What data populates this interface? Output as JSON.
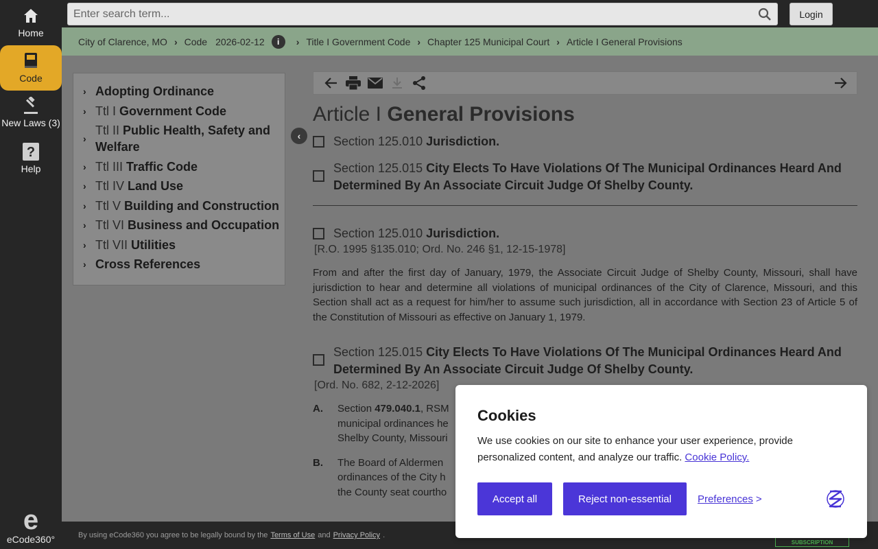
{
  "rail": {
    "home_label": "Home",
    "code_label": "Code",
    "new_laws_label": "New Laws (3)",
    "help_label": "Help",
    "logo_text": "eCode360°"
  },
  "search": {
    "placeholder": "Enter search term..."
  },
  "login_label": "Login",
  "breadcrumb": {
    "items": [
      "City of Clarence, MO",
      "Code",
      "2026-02-12",
      "Title I Government Code",
      "Chapter 125 Municipal Court",
      "Article I General Provisions"
    ]
  },
  "toc": {
    "items": [
      {
        "prefix": "",
        "title": "Adopting Ordinance"
      },
      {
        "prefix": "Ttl I",
        "title": "Government Code"
      },
      {
        "prefix": "Ttl II",
        "title": "Public Health, Safety and Welfare"
      },
      {
        "prefix": "Ttl III",
        "title": "Traffic Code"
      },
      {
        "prefix": "Ttl IV",
        "title": "Land Use"
      },
      {
        "prefix": "Ttl V",
        "title": "Building and Construction"
      },
      {
        "prefix": "Ttl VI",
        "title": "Business and Occupation"
      },
      {
        "prefix": "Ttl VII",
        "title": "Utilities"
      },
      {
        "prefix": "",
        "title": "Cross References"
      }
    ]
  },
  "article": {
    "prefix": "Article I",
    "title": "General Provisions",
    "toc_sections": [
      {
        "number": "Section 125.010",
        "title": "Jurisdiction."
      },
      {
        "number": "Section 125.015",
        "title": "City Elects To Have Violations Of The Municipal Ordinances Heard And Determined By An Associate Circuit Judge Of Shelby County."
      }
    ],
    "sections": [
      {
        "number": "Section 125.010",
        "title": "Jurisdiction.",
        "history": "[R.O. 1995 §135.010; Ord. No. 246 §1, 12-15-1978]",
        "text": "From and after the first day of January, 1979, the Associate Circuit Judge of Shelby County, Missouri, shall have jurisdiction to hear and determine all violations of municipal ordinances of the City of Clarence, Missouri, and this Section shall act as a request for him/her to assume such jurisdiction, all in accordance with Section 23 of Article 5 of the Constitution of Missouri as effective on January 1, 1979."
      },
      {
        "number": "Section 125.015",
        "title": "City Elects To Have Violations Of The Municipal Ordinances Heard And Determined By An Associate Circuit Judge Of Shelby County.",
        "history": "[Ord. No. 682, 2-12-2026]",
        "sub_a_label": "A.",
        "sub_a_pre": "Section",
        "sub_a_ref": "479.040.1",
        "sub_a_text": ", RSM",
        "sub_a_line2": "municipal ordinances he",
        "sub_a_line3": "Shelby County, Missouri",
        "sub_b_label": "B.",
        "sub_b_line1": "The Board of Aldermen",
        "sub_b_line2": "ordinances of the City h",
        "sub_b_line3": "the County seat courtho"
      }
    ]
  },
  "footer": {
    "pre": "By using eCode360 you agree to be legally bound by the",
    "terms": "Terms of Use",
    "and": "and",
    "privacy": "Privacy Policy",
    "dot": ".",
    "badge": "SUBSCRIPTION"
  },
  "cookie": {
    "title": "Cookies",
    "text": "We use cookies on our site to enhance your user experience, provide personalized content, and analyze our traffic.",
    "policy_link": "Cookie Policy.",
    "accept": "Accept all",
    "reject": "Reject non-essential",
    "preferences": "Preferences",
    "pref_arrow": ">"
  }
}
